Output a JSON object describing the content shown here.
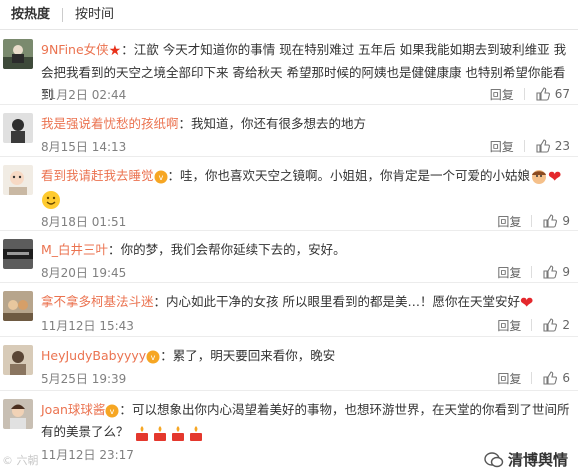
{
  "tabs": {
    "hot": "按热度",
    "time": "按时间"
  },
  "actions": {
    "reply": "回复"
  },
  "comments": [
    {
      "user": "9NFine女侠",
      "sep": "：",
      "text": "江歆 今天才知道你的事情 现在特别难过 五年后 如果我能如期去到玻利维亚 我会把我看到的天空之境全部印下来 寄给秋天 希望那时候的阿姨也是健健康康 也特别希望你能看到",
      "time": "11月2日 02:44",
      "likes": "67"
    },
    {
      "user": "我是强说着忧愁的孩纸啊",
      "sep": "：",
      "text": "我知道，你还有很多想去的地方",
      "time": "8月15日 14:13",
      "likes": "23"
    },
    {
      "user": "看到我请赶我去睡觉",
      "sep": "：",
      "text": "哇，你也喜欢天空之镜啊。小姐姐，你肯定是一个可爱的小姑娘",
      "time": "8月18日 01:51",
      "likes": "9"
    },
    {
      "user": "M_白井三叶",
      "sep": "：",
      "text": "你的梦，我们会帮你延续下去的，安好。",
      "time": "8月20日 19:45",
      "likes": "9"
    },
    {
      "user": "拿不拿多柯基法斗迷",
      "sep": "：",
      "text": "内心如此干净的女孩 所以眼里看到的都是美…！愿你在天堂安好",
      "time": "11月12日 15:43",
      "likes": "2"
    },
    {
      "user": "HeyJudyBabyyyy",
      "sep": "：",
      "text": "累了，明天要回来看你，晚安",
      "time": "5月25日 19:39",
      "likes": "6"
    },
    {
      "user": "Joan球球酱",
      "sep": "：",
      "text": "可以想象出你内心渴望着美好的事物，也想环游世界，在天堂的你看到了世间所有的美景了么？",
      "time": "11月12日 23:17",
      "likes": ""
    }
  ],
  "watermark": {
    "left": "© 六朝",
    "right": "清博舆情"
  },
  "colors": {
    "username": "#eb7350",
    "time": "#808080",
    "heart": "#e4282d"
  }
}
